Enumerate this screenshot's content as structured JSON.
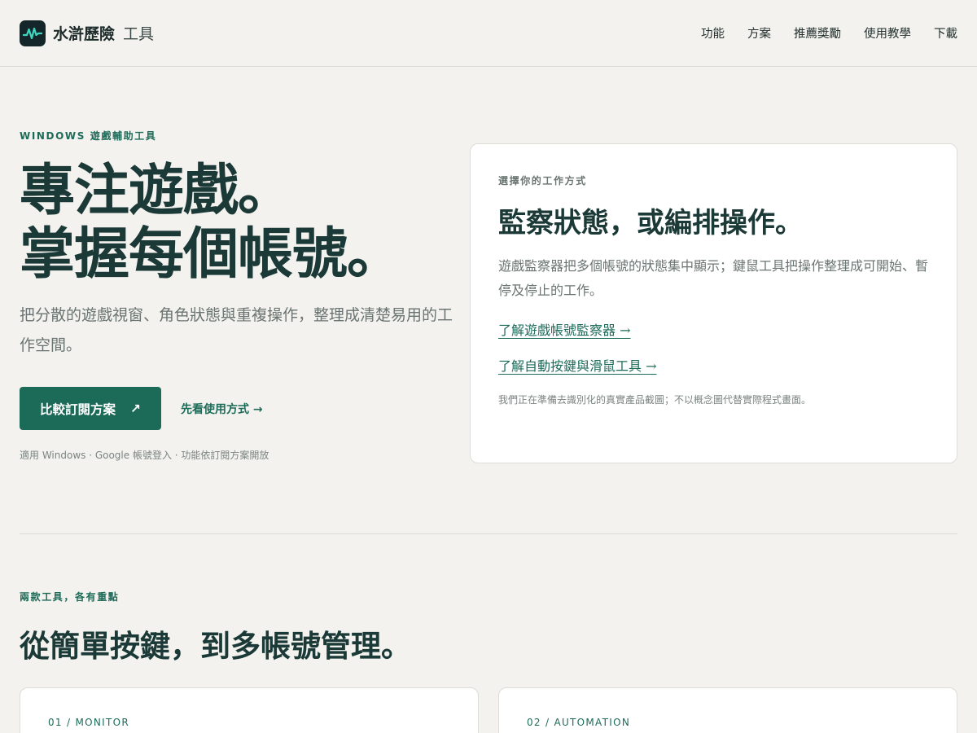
{
  "header": {
    "brand_name": "水滸歷險",
    "brand_sub": "工具",
    "nav": [
      "功能",
      "方案",
      "推薦獎勵",
      "使用教學",
      "下載"
    ]
  },
  "hero": {
    "eyebrow": "WINDOWS 遊戲輔助工具",
    "title_line1": "專注遊戲。",
    "title_line2": "掌握每個帳號。",
    "description": "把分散的遊戲視窗、角色狀態與重複操作，整理成清楚易用的工作空間。",
    "primary_button": "比較訂閱方案",
    "primary_button_icon": "↗",
    "secondary_link": "先看使用方式 →",
    "note": "適用 Windows · Google 帳號登入 · 功能依訂閱方案開放"
  },
  "card": {
    "eyebrow": "選擇你的工作方式",
    "title": "監察狀態，或編排操作。",
    "description": "遊戲監察器把多個帳號的狀態集中顯示；鍵鼠工具把操作整理成可開始、暫停及停止的工作。",
    "link1": "了解遊戲帳號監察器 →",
    "link2": "了解自動按鍵與滑鼠工具 →",
    "note": "我們正在準備去識別化的真實產品截圖；不以概念圖代替實際程式畫面。"
  },
  "section": {
    "eyebrow": "兩款工具，各有重點",
    "title": "從簡單按鍵，到多帳號管理。",
    "cards": [
      "01 / MONITOR",
      "02 / AUTOMATION"
    ]
  },
  "colors": {
    "accent": "#1b6b58",
    "background": "#f3f2ee",
    "text_dark": "#1b3a37"
  },
  "icons": {
    "logo": "pulse-wave-icon",
    "button": "arrow-up-right-icon"
  }
}
